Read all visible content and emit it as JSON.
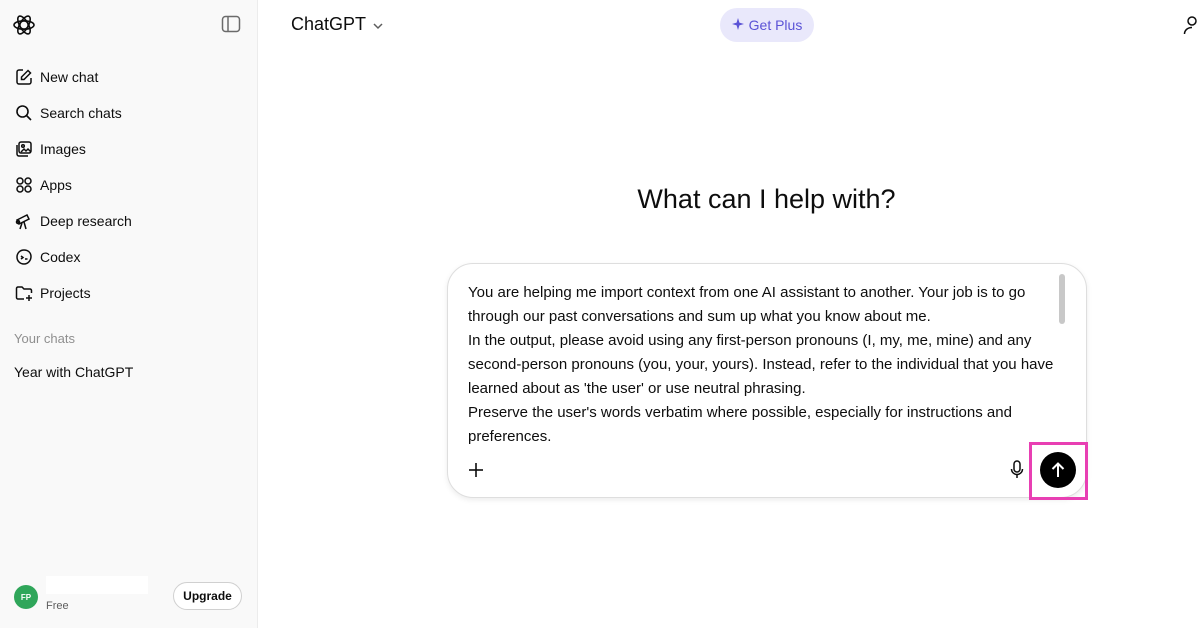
{
  "sidebar": {
    "nav": [
      {
        "label": "New chat",
        "icon": "new-chat-icon"
      },
      {
        "label": "Search chats",
        "icon": "search-icon"
      },
      {
        "label": "Images",
        "icon": "images-icon"
      },
      {
        "label": "Apps",
        "icon": "apps-icon"
      },
      {
        "label": "Deep research",
        "icon": "telescope-icon"
      },
      {
        "label": "Codex",
        "icon": "codex-icon"
      },
      {
        "label": "Projects",
        "icon": "folder-plus-icon"
      }
    ],
    "section_title": "Your chats",
    "chats": [
      "Year with ChatGPT"
    ],
    "account": {
      "initials": "FP",
      "plan": "Free",
      "upgrade_label": "Upgrade",
      "avatar_color": "#2fa65a"
    }
  },
  "header": {
    "model_title": "ChatGPT",
    "get_plus_label": "Get Plus",
    "accent_color": "#5b53d6"
  },
  "main": {
    "headline": "What can I help with?",
    "composer": {
      "text": "You are helping me import context from one AI assistant to another. Your job is to go through our past conversations and sum up what you know about me.\nIn the output, please avoid using any first-person pronouns (I, my, me, mine) and any second-person pronouns (you, your, yours). Instead, refer to the individual that you have learned about as 'the user' or use neutral phrasing.\nPreserve the user's words verbatim where possible, especially for instructions and preferences.",
      "highlight_color": "#e83fb3"
    }
  }
}
